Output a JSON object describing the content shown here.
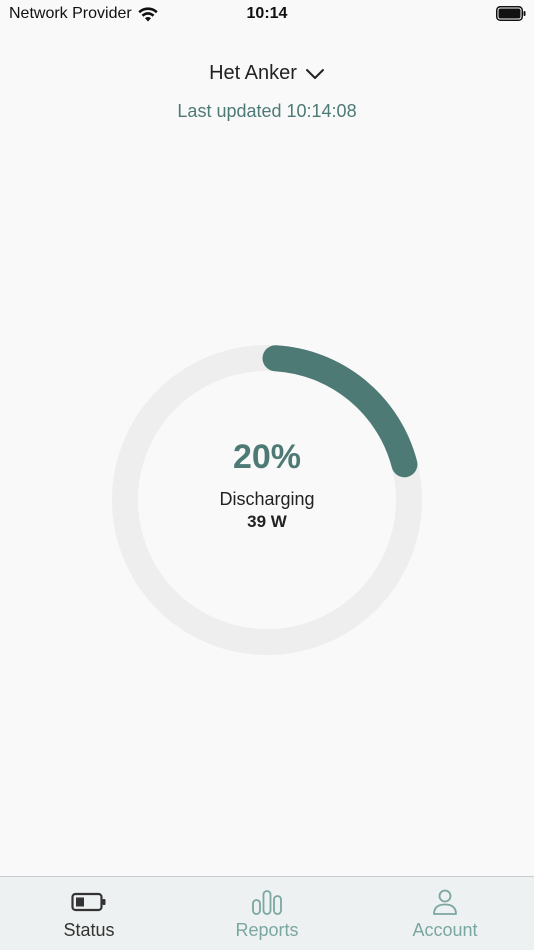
{
  "status_bar": {
    "carrier": "Network Provider",
    "time": "10:14"
  },
  "header": {
    "location": "Het Anker",
    "last_updated": "Last updated 10:14:08"
  },
  "battery": {
    "percent_label": "20%",
    "charge_fraction": 0.2,
    "state": "Discharging",
    "power": "39 W"
  },
  "colors": {
    "accent": "#4e7a75",
    "track": "#eeeeee",
    "tab_inactive": "#7aa7a1"
  },
  "tabs": [
    {
      "label": "Status",
      "icon": "battery-icon",
      "active": true
    },
    {
      "label": "Reports",
      "icon": "bar-chart-icon",
      "active": false
    },
    {
      "label": "Account",
      "icon": "person-icon",
      "active": false
    }
  ]
}
